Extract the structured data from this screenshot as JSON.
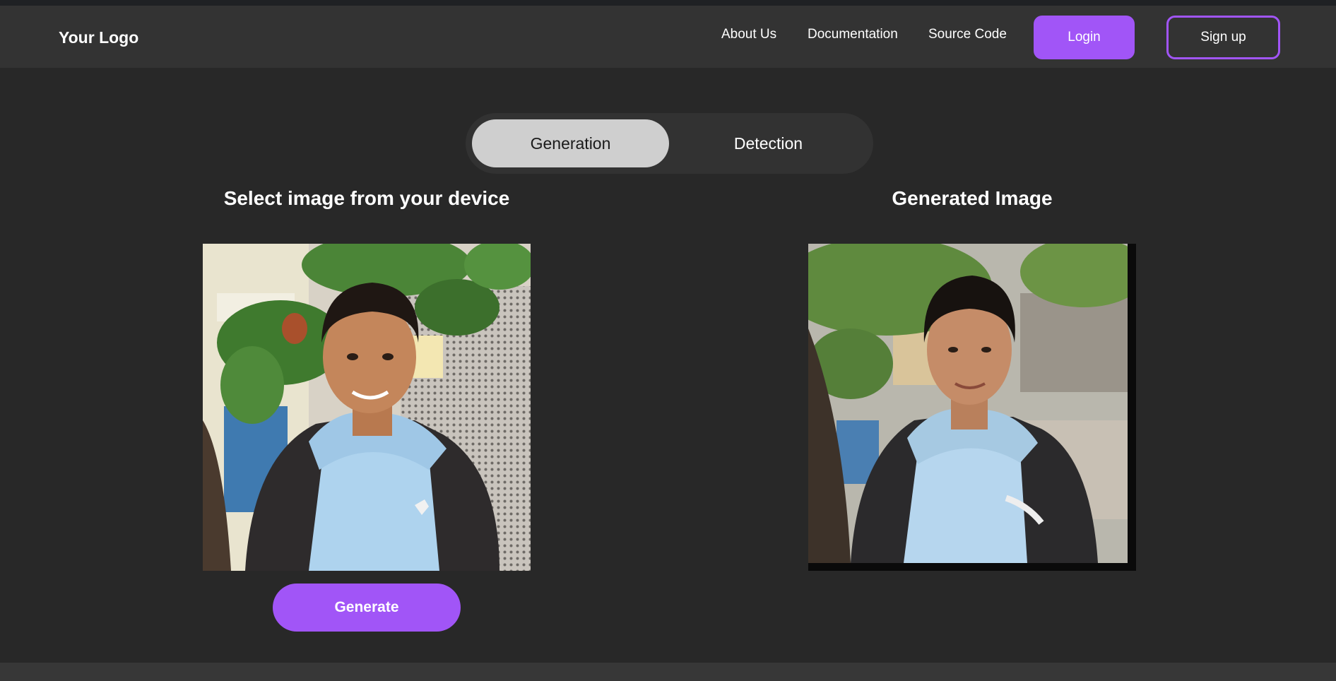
{
  "navbar": {
    "logo": "Your Logo",
    "links": [
      "About Us",
      "Documentation",
      "Source Code"
    ],
    "login_label": "Login",
    "signup_label": "Sign up"
  },
  "tabs": [
    {
      "label": "Generation",
      "active": true
    },
    {
      "label": "Detection",
      "active": false
    }
  ],
  "upload_section": {
    "title": "Select image from your device",
    "generate_label": "Generate"
  },
  "result_section": {
    "title": "Generated Image"
  },
  "colors": {
    "accent": "#a155f7",
    "background": "#282828",
    "navbar": "#333333",
    "active_tab": "#cfcfcf"
  }
}
